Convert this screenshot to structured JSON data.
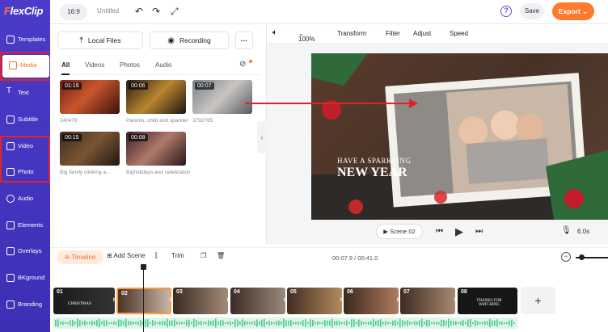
{
  "app": {
    "logo_prefix": "F",
    "logo_rest": "lexClip"
  },
  "topbar": {
    "ratio": "16:9",
    "title": "Untitled",
    "save": "Save",
    "export": "Export"
  },
  "rail": [
    {
      "label": "Templates"
    },
    {
      "label": "Media"
    },
    {
      "label": "Text"
    },
    {
      "label": "Subtitle"
    },
    {
      "label": "Video"
    },
    {
      "label": "Photo"
    },
    {
      "label": "Audio"
    },
    {
      "label": "Elements"
    },
    {
      "label": "Overlays"
    },
    {
      "label": "BKground"
    },
    {
      "label": "Branding"
    }
  ],
  "panel": {
    "local_files": "Local Files",
    "recording": "Recording",
    "more": "···",
    "tabs": [
      "All",
      "Videos",
      "Photos",
      "Audio"
    ],
    "items": [
      {
        "duration": "01:19",
        "caption": "140476"
      },
      {
        "duration": "00:06",
        "caption": "Parents, child and sparklers"
      },
      {
        "duration": "00:07",
        "caption": "3792765"
      },
      {
        "duration": "00:15",
        "caption": "Big family clinking a..."
      },
      {
        "duration": "00:08",
        "caption": "Bigholidays and celebration..."
      }
    ]
  },
  "toolbar": {
    "zoom": "100%",
    "transform": "Transform",
    "filter": "Filter",
    "adjust": "Adjust",
    "speed": "Speed"
  },
  "preview": {
    "line1": "HAVE A SPARKLING",
    "line2": "NEW YEAR"
  },
  "player": {
    "scene": "Scene 02",
    "duration": "6.0s"
  },
  "timeline": {
    "tab": "Timeline",
    "add_scene": "Add Scene",
    "trim": "Trim",
    "time": "00:07.9 / 00:41.0",
    "clips": [
      "01",
      "02",
      "03",
      "04",
      "05",
      "06",
      "07",
      "08"
    ],
    "clip1_text": "CHRISTMAS",
    "clip8_text": "THANKS FOR WATCHING",
    "add": "+"
  },
  "colors": {
    "rail": "#4b3bc9",
    "accent": "#ff7a2d",
    "highlight": "#e0242a"
  }
}
